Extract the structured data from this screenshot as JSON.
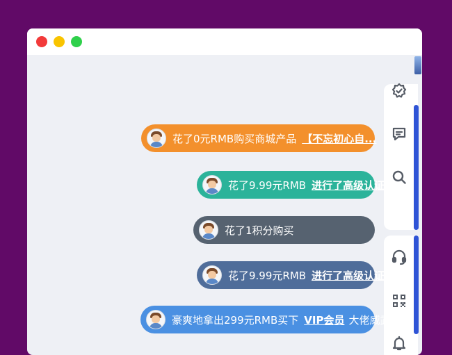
{
  "notifications": [
    {
      "text": "花了0元RMB购买商城产品",
      "link": "【不忘初心自...",
      "tail": "",
      "color": "#f3902c"
    },
    {
      "text": "花了9.99元RMB",
      "link": "进行了高级认证",
      "tail": "",
      "color": "#2bb39a"
    },
    {
      "text": "花了1积分购买",
      "link": "",
      "tail": "",
      "color": "#566270"
    },
    {
      "text": "花了9.99元RMB",
      "link": "进行了高级认证",
      "tail": "",
      "color": "#4f6d9a"
    },
    {
      "text": "豪爽地拿出299元RMB买下",
      "link": "VIP会员",
      "tail": "大佬威武",
      "color": "#4a90e2"
    }
  ],
  "sidebar": {
    "icons": [
      "verified-badge-icon",
      "message-icon",
      "search-icon",
      "headset-icon",
      "qr-code-icon",
      "bell-icon"
    ],
    "accent_color": "#2f54d6"
  },
  "window": {
    "controls": [
      "close",
      "minimize",
      "maximize"
    ],
    "background": "#610a67"
  }
}
